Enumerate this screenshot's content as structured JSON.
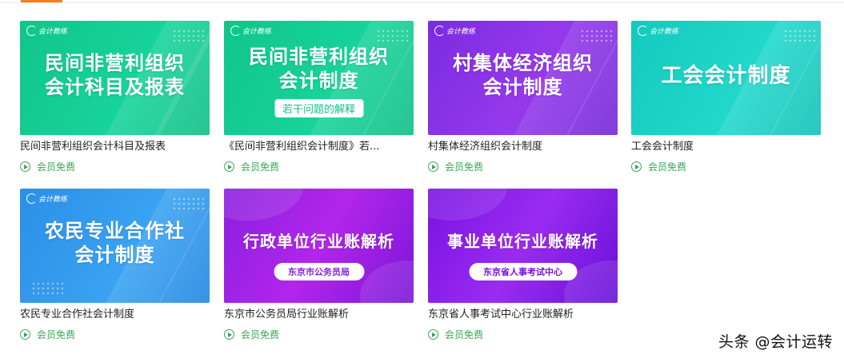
{
  "cards": [
    {
      "thumb_lines": [
        "民间非营利组织",
        "会计科目及报表"
      ],
      "logo": "会计教练",
      "title": "民间非营利组织会计科目及报表",
      "meta": "会员免费"
    },
    {
      "thumb_lines": [
        "民间非营利组织",
        "会计制度"
      ],
      "thumb_badge": "若干问题的解释",
      "logo": "会计教练",
      "title": "《民间非营利组织会计制度》若...",
      "meta": "会员免费"
    },
    {
      "thumb_lines": [
        "村集体经济组织",
        "会计制度"
      ],
      "logo": "会计教练",
      "title": "村集体经济组织会计制度",
      "meta": "会员免费"
    },
    {
      "thumb_lines": [
        "工会会计制度"
      ],
      "logo": "会计教练",
      "title": "工会会计制度",
      "meta": "会员免费"
    },
    {
      "thumb_lines": [
        "农民专业合作社",
        "会计制度"
      ],
      "logo": "会计教练",
      "title": "农民专业合作社会计制度",
      "meta": "会员免费"
    },
    {
      "thumb_lines": [
        "行政单位行业账解析"
      ],
      "thumb_pill": "东京市公务员局",
      "title": "东京市公务员局行业账解析",
      "meta": "会员免费"
    },
    {
      "thumb_lines": [
        "事业单位行业账解析"
      ],
      "thumb_pill": "东京省人事考试中心",
      "title": "东京省人事考试中心行业账解析",
      "meta": "会员免费"
    }
  ],
  "watermark": "头条 @会计运转",
  "colors": {
    "accent": "#ff7a1a",
    "meta_green": "#3aa655",
    "badge_green": "#17c08a",
    "pill_purple": "#8a1fe0"
  }
}
